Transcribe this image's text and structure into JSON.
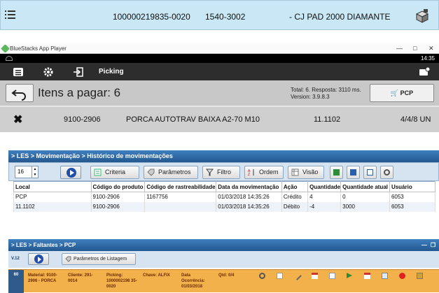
{
  "panel1": {
    "code": "100000219835-0020",
    "ref": "1540-3002",
    "description": "- CJ PAD 2000 DIAMANTE"
  },
  "panel2": {
    "app_title": "BlueStacks App Player",
    "time": "14:35",
    "nav_title": "Picking",
    "heading": "Itens a pagar: 6",
    "info_line1": "Total: 6. Resposta: 3110 ms.",
    "info_line2": "Version: 3.9.8.3",
    "pcp_label": "PCP",
    "row": {
      "code": "9100-2906",
      "description": "PORCA AUTOTRAV BAIXA A2-70 M10",
      "location": "11.1102",
      "quantity": "4/4/8 UN"
    }
  },
  "panel3": {
    "breadcrumb": "> LES > Movimentação > Histórico de movimentações",
    "page_size": "16",
    "buttons": {
      "criteria": "Criteria",
      "params": "Parâmetros",
      "filter": "Filtro",
      "order": "Ordem",
      "view": "Visão"
    },
    "columns": [
      "Local",
      "Código do produto",
      "Código de rastreabilidade",
      "Data da movimentação",
      "Ação",
      "Quantidade",
      "Quantidade atual",
      "Usuário"
    ],
    "rows": [
      [
        "PCP",
        "9100-2906",
        "1167756",
        "01/03/2018 14:35:26",
        "Crédito",
        "4",
        "0",
        "6053"
      ],
      [
        "11.1102",
        "9100-2906",
        "",
        "01/03/2018 14:35:26",
        "Débito",
        "-4",
        "3000",
        "6053"
      ]
    ]
  },
  "panel4": {
    "breadcrumb": "> LES > Faltantes > PCP",
    "version_label": "V.12",
    "list_params": "Parâmetros de Listagem",
    "row": {
      "number": "60",
      "material": "Material: 9100-2906 - PORCA",
      "client": "Cliente: 291-0014",
      "picking": "Picking: 1000002198 35-0020",
      "key": "Chave: ALFIX",
      "date": "Data Ocorrência: 01/03/2018",
      "qty": "Qtd: 0/4"
    }
  },
  "colors": {
    "row_blue": "#c9e7f5",
    "header_blue": "#2f6aa8",
    "orange": "#f2b14a"
  }
}
